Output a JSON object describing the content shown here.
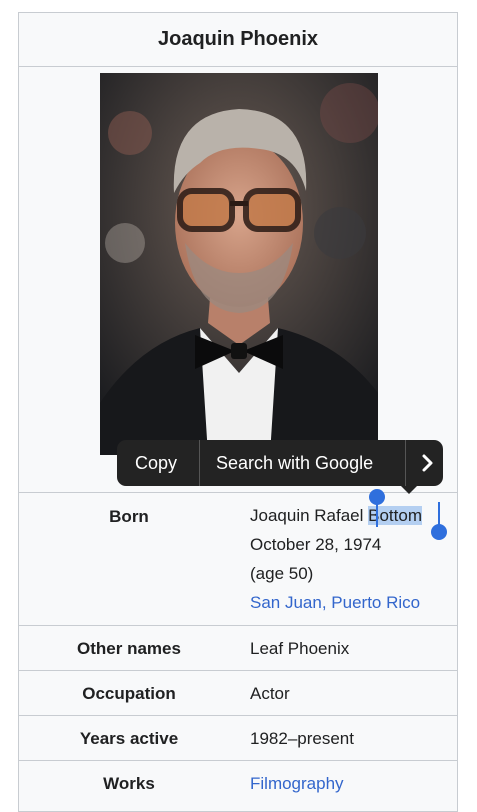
{
  "infobox": {
    "title": "Joaquin Phoenix",
    "rows": [
      {
        "label": "Born",
        "lines": [
          "Joaquin Rafael ",
          "October 28, 1974",
          "(age 50)",
          "San Juan, Puerto Rico"
        ],
        "selected": "Bottom"
      },
      {
        "label": "Other names",
        "value": "Leaf Phoenix"
      },
      {
        "label": "Occupation",
        "value": "Actor"
      },
      {
        "label": "Years active",
        "value": "1982–present"
      },
      {
        "label": "Works",
        "value": "Filmography"
      }
    ]
  },
  "context_menu": {
    "copy": "Copy",
    "search": "Search with Google",
    "more_icon": "chevron-right-icon"
  },
  "colors": {
    "link": "#3366cc",
    "selection": "#b4cff1",
    "handle": "#2f6fdd",
    "menu_bg": "#232323"
  }
}
